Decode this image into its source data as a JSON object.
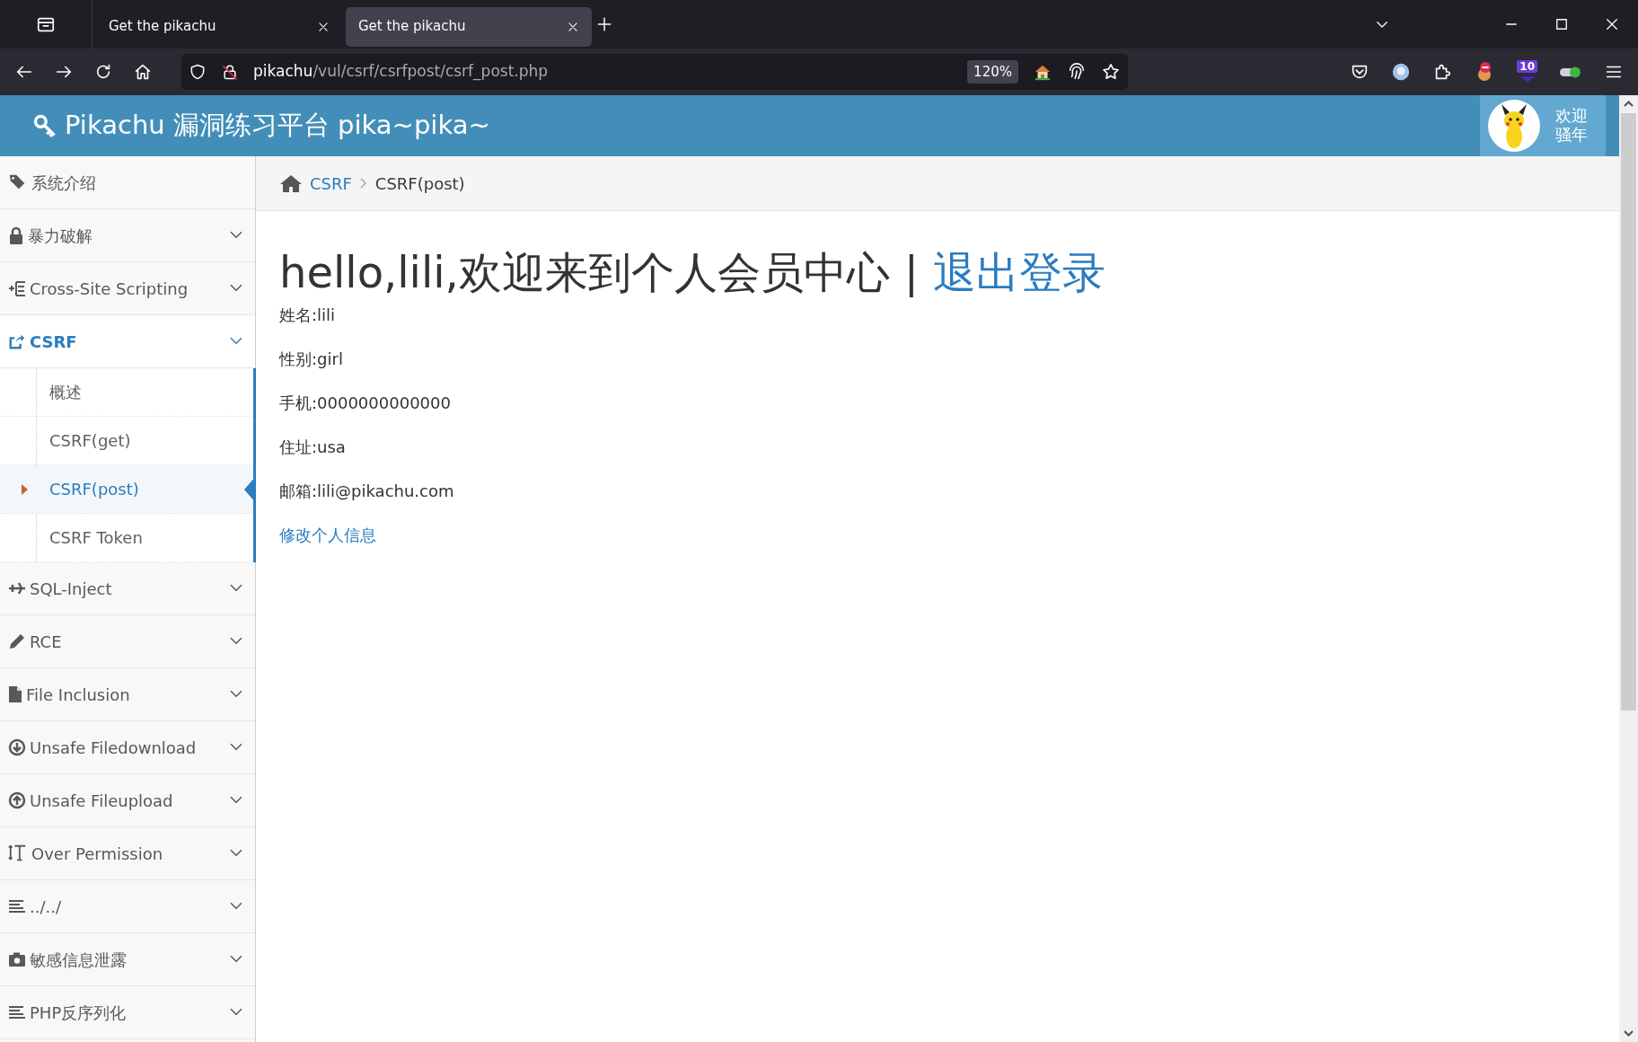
{
  "browser": {
    "tabs": [
      {
        "title": "Get the pikachu",
        "selected": false
      },
      {
        "title": "Get the pikachu",
        "selected": true
      }
    ],
    "url": {
      "host": "pikachu",
      "path": "/vul/csrf/csrfpost/csrf_post.php"
    },
    "zoom": "120%",
    "extension_badge": "10"
  },
  "header": {
    "title": "Pikachu 漏洞练习平台 pika~pika~",
    "user_greeting": [
      "欢迎",
      "骚年"
    ]
  },
  "sidebar": {
    "items": [
      {
        "label": "系统介绍",
        "expandable": false,
        "selected": false
      },
      {
        "label": "暴力破解",
        "expandable": true,
        "expanded": false,
        "selected": false
      },
      {
        "label": "Cross-Site Scripting",
        "expandable": true,
        "expanded": false,
        "selected": false
      },
      {
        "label": "CSRF",
        "expandable": true,
        "expanded": true,
        "selected": true,
        "children": [
          {
            "label": "概述",
            "selected": false
          },
          {
            "label": "CSRF(get)",
            "selected": false
          },
          {
            "label": "CSRF(post)",
            "selected": true
          },
          {
            "label": "CSRF Token",
            "selected": false
          }
        ]
      },
      {
        "label": "SQL-Inject",
        "expandable": true,
        "expanded": false,
        "selected": false
      },
      {
        "label": "RCE",
        "expandable": true,
        "expanded": false,
        "selected": false
      },
      {
        "label": "File Inclusion",
        "expandable": true,
        "expanded": false,
        "selected": false
      },
      {
        "label": "Unsafe Filedownload",
        "expandable": true,
        "expanded": false,
        "selected": false
      },
      {
        "label": "Unsafe Fileupload",
        "expandable": true,
        "expanded": false,
        "selected": false
      },
      {
        "label": "Over Permission",
        "expandable": true,
        "expanded": false,
        "selected": false
      },
      {
        "label": "../../",
        "expandable": true,
        "expanded": false,
        "selected": false
      },
      {
        "label": "敏感信息泄露",
        "expandable": true,
        "expanded": false,
        "selected": false
      },
      {
        "label": "PHP反序列化",
        "expandable": true,
        "expanded": false,
        "selected": false
      }
    ]
  },
  "breadcrumb": [
    {
      "label": "CSRF",
      "link": true
    },
    {
      "label": "CSRF(post)",
      "link": false
    }
  ],
  "content": {
    "heading": "hello,lili,欢迎来到个人会员中心",
    "separator": "|",
    "logout_link": "退出登录",
    "fields": [
      "姓名:lili",
      "性别:girl",
      "手机:0000000000000",
      "住址:usa",
      "邮箱:lili@pikachu.com"
    ],
    "edit_link": "修改个人信息"
  }
}
